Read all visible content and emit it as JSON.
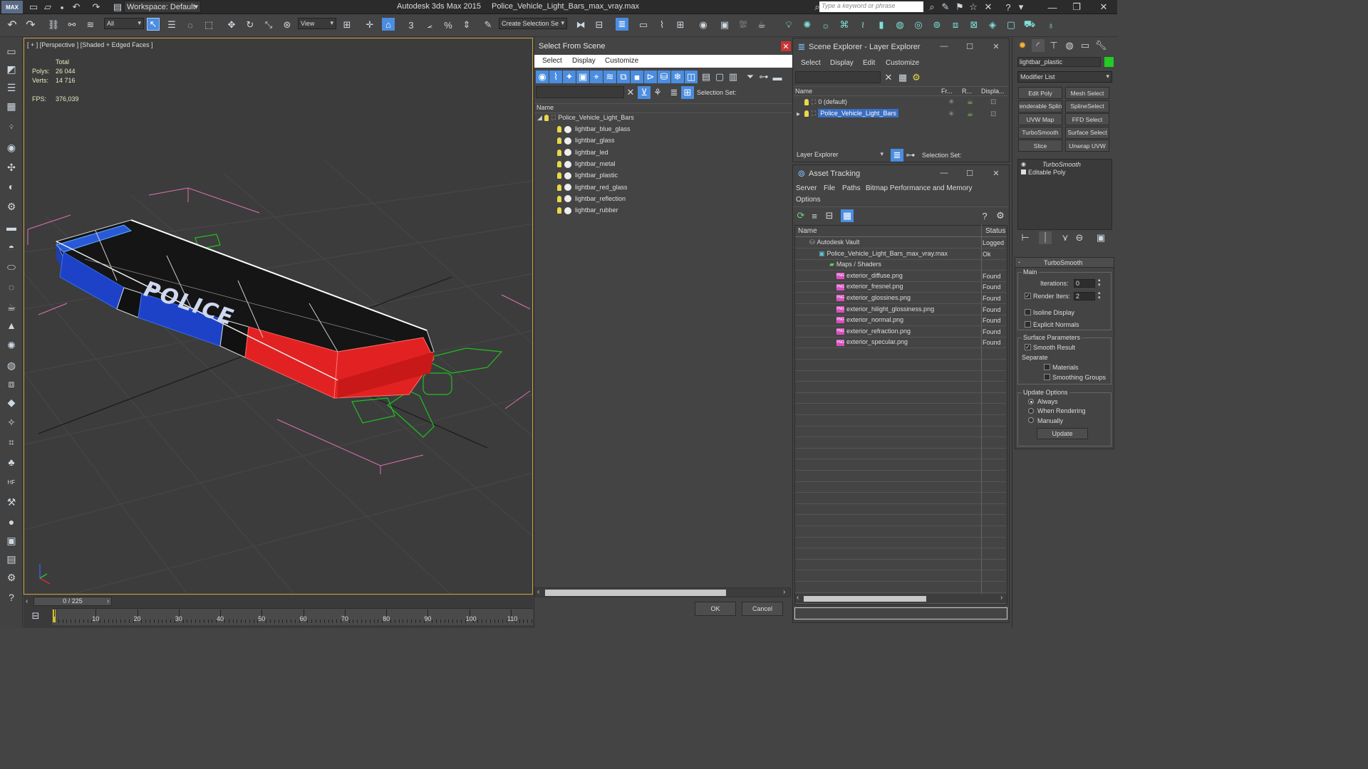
{
  "app": {
    "workspace": "Workspace: Default",
    "title_app": "Autodesk 3ds Max  2015",
    "title_file": "Police_Vehicle_Light_Bars_max_vray.max",
    "search_placeholder": "Type a keyword or phrase"
  },
  "toolbar": {
    "filter_value": "All",
    "view_value": "View",
    "selection_set_placeholder": "Create Selection Se",
    "snap_3": "3",
    "snap_pct": "%",
    "angle_snap": "n"
  },
  "viewport": {
    "label": "[ + ] [Perspective ] [Shaded + Edged Faces ]",
    "stats": {
      "header": "Total",
      "polys_label": "Polys:",
      "polys_value": "26 044",
      "verts_label": "Verts:",
      "verts_value": "14 716",
      "fps_label": "FPS:",
      "fps_value": "376,039"
    },
    "model_text": "POLICE"
  },
  "timeline": {
    "frame_counter": "0 / 225",
    "ticks": [
      "10",
      "20",
      "30",
      "40",
      "50",
      "60",
      "70",
      "80",
      "90",
      "100",
      "110"
    ]
  },
  "select_from_scene": {
    "title": "Select From Scene",
    "menu": [
      "Select",
      "Display",
      "Customize"
    ],
    "selection_set_label": "Selection Set:",
    "column_name": "Name",
    "root": "Police_Vehicle_Light_Bars",
    "items": [
      "lightbar_blue_glass",
      "lightbar_glass",
      "lightbar_led",
      "lightbar_metal",
      "lightbar_plastic",
      "lightbar_red_glass",
      "lightbar_reflection",
      "lightbar_rubber"
    ],
    "ok_label": "OK",
    "cancel_label": "Cancel"
  },
  "scene_explorer": {
    "title": "Scene Explorer - Layer Explorer",
    "menu": [
      "Select",
      "Display",
      "Edit",
      "Customize"
    ],
    "columns": [
      "Name",
      "Fr...",
      "R...",
      "Displa..."
    ],
    "layers": [
      "0 (default)",
      "Police_Vehicle_Light_Bars"
    ],
    "footer_combo": "Layer Explorer",
    "footer_selection": "Selection Set:"
  },
  "asset_tracking": {
    "title": "Asset Tracking",
    "menu": [
      "Server",
      "File",
      "Paths",
      "Bitmap Performance and Memory"
    ],
    "menu2": "Options",
    "columns": [
      "Name",
      "Status"
    ],
    "vault": {
      "name": "Autodesk Vault",
      "status": "Logged"
    },
    "file": {
      "name": "Police_Vehicle_Light_Bars_max_vray.max",
      "status": "Ok"
    },
    "maps_folder": "Maps / Shaders",
    "maps": [
      {
        "name": "exterior_diffuse.png",
        "status": "Found"
      },
      {
        "name": "exterior_fresnel.png",
        "status": "Found"
      },
      {
        "name": "exterior_glossines.png",
        "status": "Found"
      },
      {
        "name": "exterior_hilight_glossiness.png",
        "status": "Found"
      },
      {
        "name": "exterior_normal.png",
        "status": "Found"
      },
      {
        "name": "exterior_refraction.png",
        "status": "Found"
      },
      {
        "name": "exterior_specular.png",
        "status": "Found"
      }
    ],
    "png_badge": "PNG"
  },
  "command_panel": {
    "object_name": "lightbar_plastic",
    "modifier_list": "Modifier List",
    "buttons": [
      "Edit Poly",
      "Mesh Select",
      "Renderable Spline",
      "SplineSelect",
      "UVW Map",
      "FFD Select",
      "TurboSmooth",
      "Surface Select",
      "Slice",
      "Unwrap UVW"
    ],
    "stack": [
      "TurboSmooth",
      "Editable Poly"
    ],
    "rollout_title": "TurboSmooth",
    "main_group": "Main",
    "iterations_label": "Iterations:",
    "iterations_value": "0",
    "render_iters_label": "Render Iters:",
    "render_iters_value": "2",
    "isoline_label": "Isoline Display",
    "explicit_normals_label": "Explicit Normals",
    "surface_group": "Surface Parameters",
    "smooth_result_label": "Smooth Result",
    "separate_label": "Separate",
    "materials_label": "Materials",
    "smoothing_groups_label": "Smoothing Groups",
    "update_group": "Update Options",
    "update_always": "Always",
    "update_rendering": "When Rendering",
    "update_manually": "Manually",
    "update_button": "Update"
  },
  "colors": {
    "accent_blue": "#2f6fd1",
    "selection_highlight": "#3a6ec2",
    "viewport_border": "#c9a13a",
    "wire_green": "#20c020"
  }
}
